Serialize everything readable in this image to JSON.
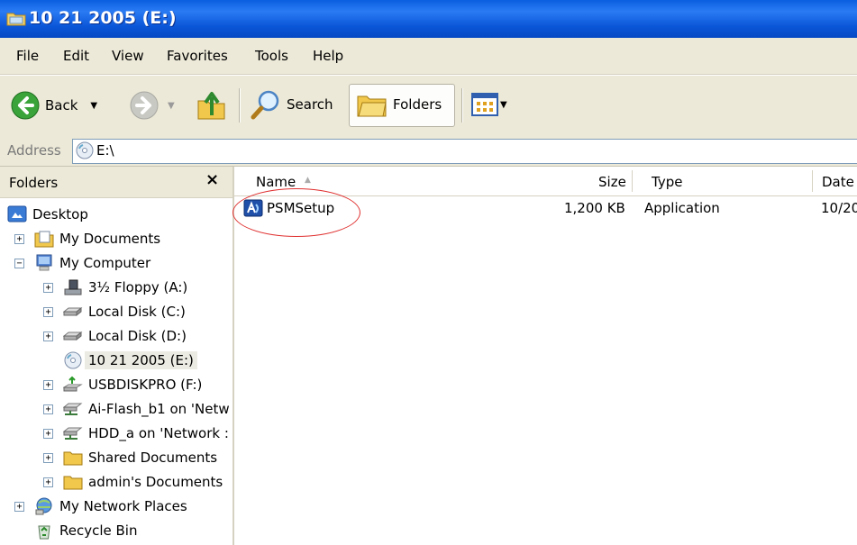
{
  "window": {
    "title": "10 21 2005 (E:)"
  },
  "menu": [
    {
      "label": "File"
    },
    {
      "label": "Edit"
    },
    {
      "label": "View"
    },
    {
      "label": "Favorites"
    },
    {
      "label": "Tools"
    },
    {
      "label": "Help"
    }
  ],
  "toolbar": {
    "back_label": "Back",
    "search_label": "Search",
    "folders_label": "Folders"
  },
  "address": {
    "label": "Address",
    "value": "E:\\"
  },
  "folders_pane": {
    "title": "Folders",
    "close_glyph": "×",
    "tree": [
      {
        "label": "Desktop",
        "icon": "desktop-icon"
      },
      {
        "label": "My Documents",
        "icon": "my-documents-icon"
      },
      {
        "label": "My Computer",
        "icon": "my-computer-icon"
      },
      {
        "label": "3½ Floppy (A:)",
        "icon": "floppy-icon"
      },
      {
        "label": "Local Disk (C:)",
        "icon": "hard-disk-icon"
      },
      {
        "label": "Local Disk (D:)",
        "icon": "hard-disk-icon"
      },
      {
        "label": "10 21 2005 (E:)",
        "icon": "cd-drive-icon",
        "selected": true
      },
      {
        "label": "USBDISKPRO (F:)",
        "icon": "usb-drive-icon"
      },
      {
        "label": "Ai-Flash_b1 on 'Netw",
        "icon": "network-drive-icon"
      },
      {
        "label": "HDD_a on 'Network :",
        "icon": "network-drive-icon"
      },
      {
        "label": "Shared Documents",
        "icon": "folder-icon"
      },
      {
        "label": "admin's Documents",
        "icon": "folder-icon"
      },
      {
        "label": "My Network Places",
        "icon": "network-places-icon"
      },
      {
        "label": "Recycle Bin",
        "icon": "recycle-bin-icon"
      }
    ]
  },
  "file_list": {
    "columns": [
      "Name",
      "Size",
      "Type",
      "Date"
    ],
    "rows": [
      {
        "name": "PSMSetup",
        "size": "1,200 KB",
        "type": "Application",
        "date": "10/20"
      }
    ]
  },
  "colors": {
    "titlebar": "#0a56d8",
    "chrome": "#ece9d8",
    "annotation_circle": "#e03030"
  }
}
